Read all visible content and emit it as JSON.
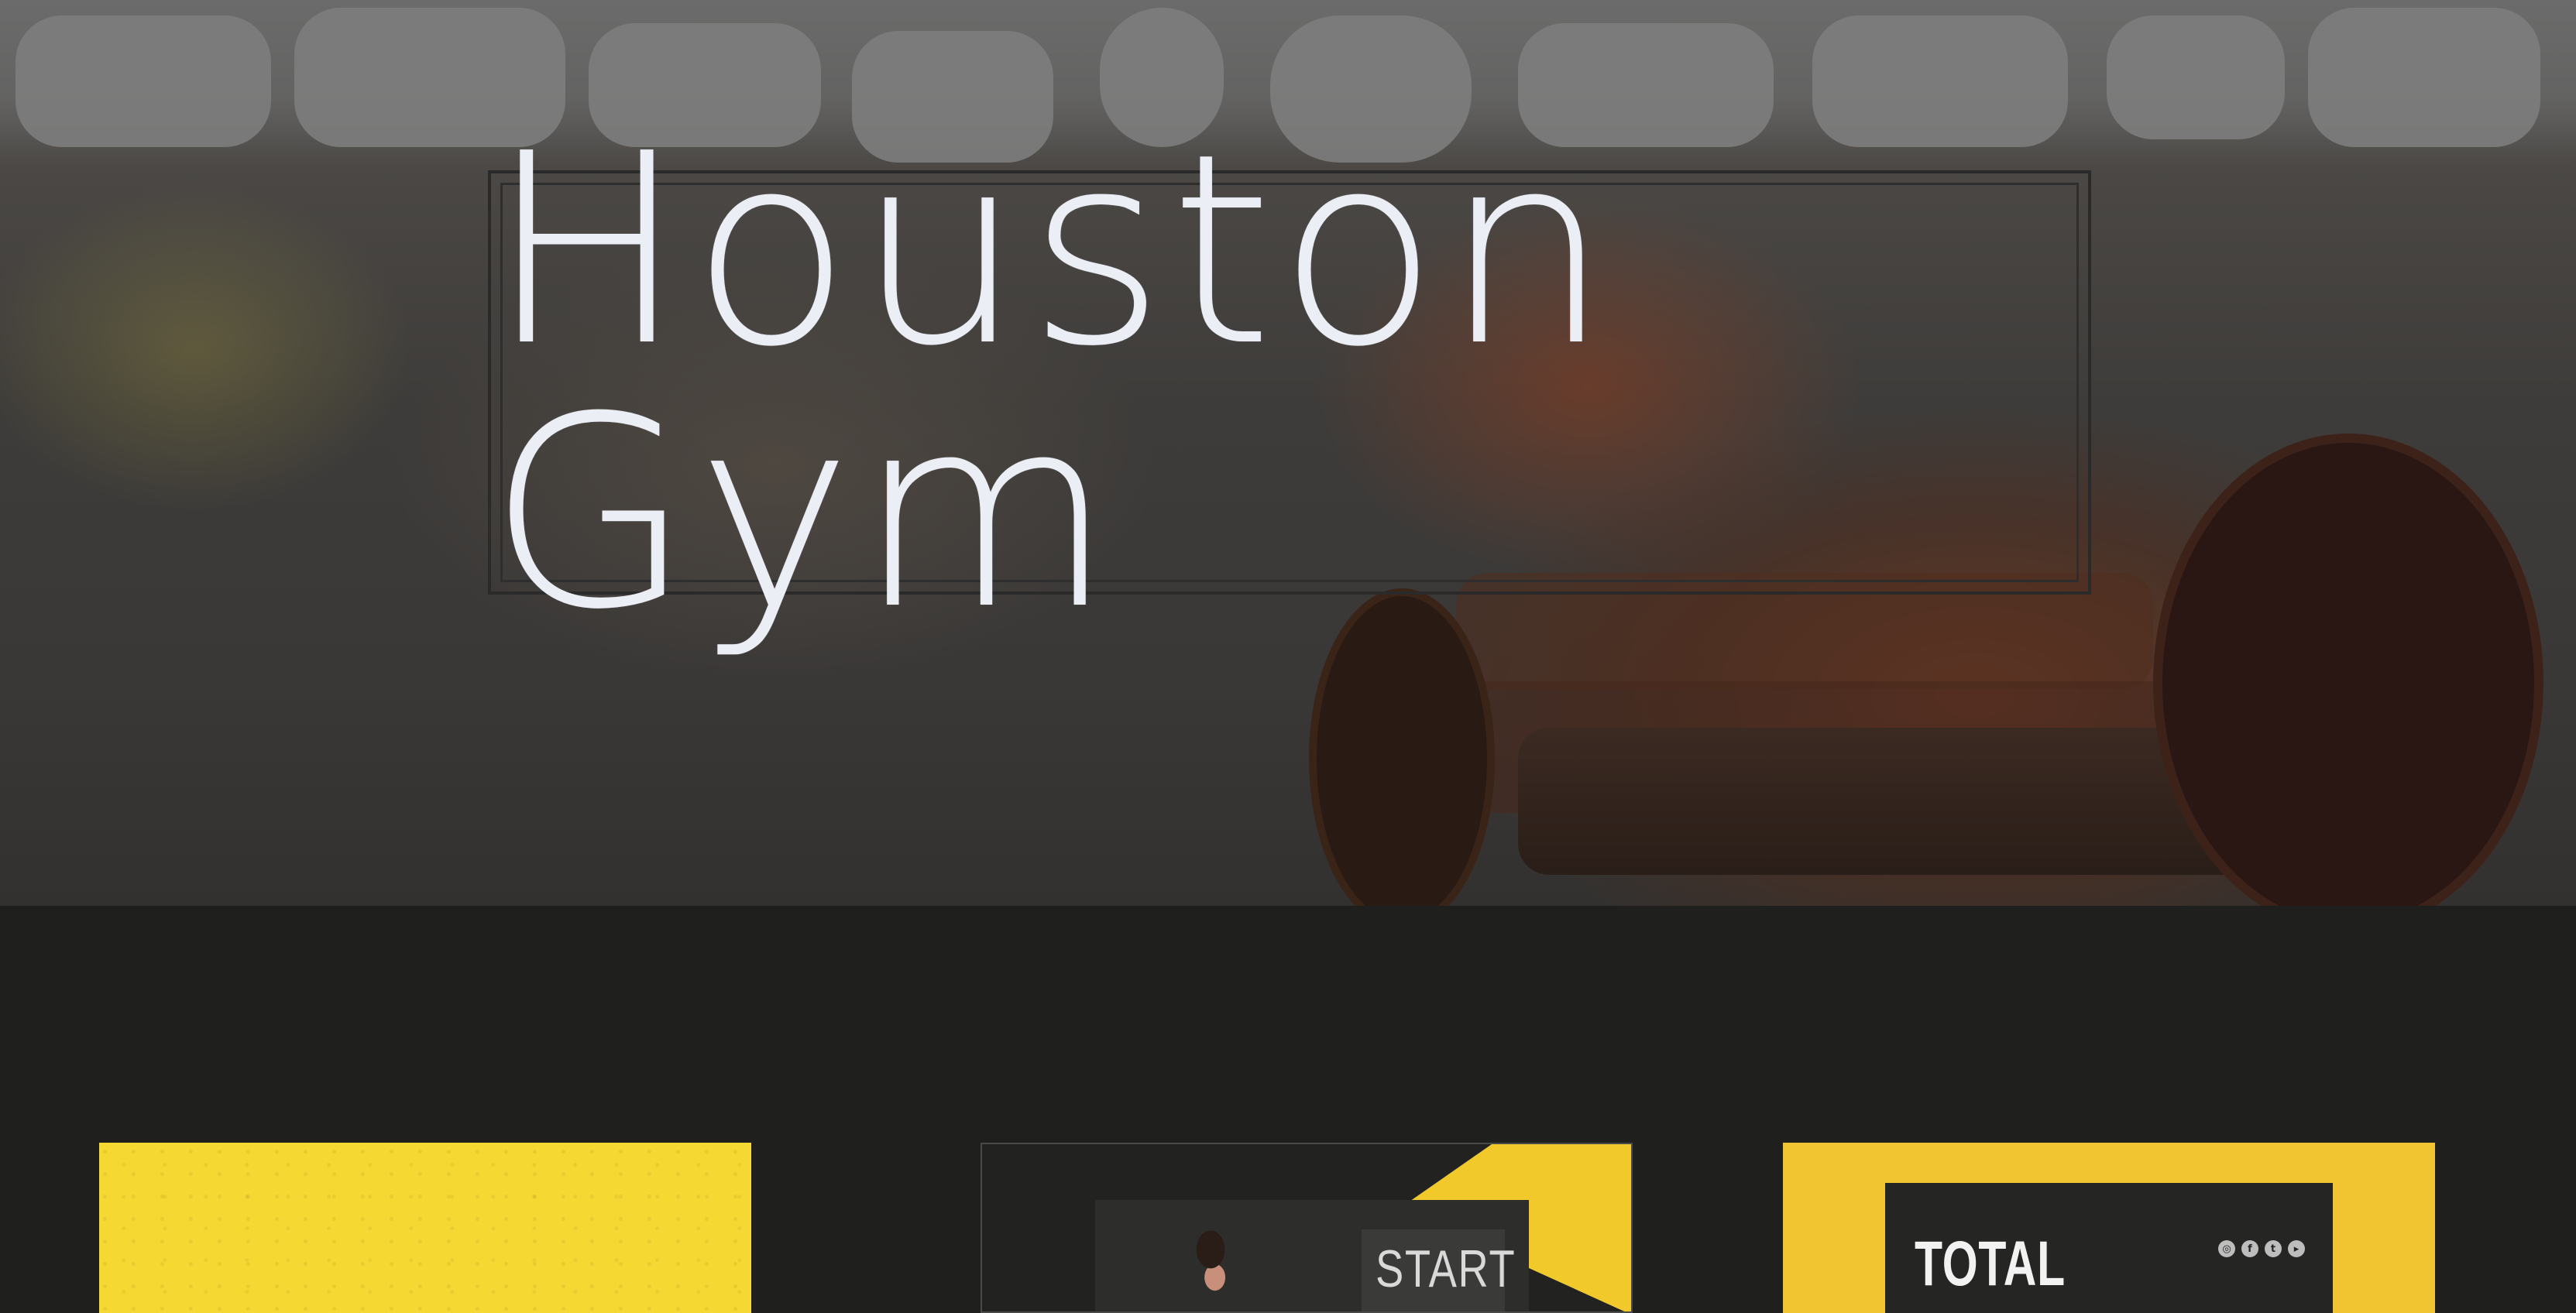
{
  "hero": {
    "title": "Houston Gym"
  },
  "cards": [
    {
      "id": "card-1",
      "text": ""
    },
    {
      "id": "card-2",
      "headline": "START"
    },
    {
      "id": "card-3",
      "headline": "TOTAL",
      "social_icons": [
        "instagram-icon",
        "facebook-icon",
        "twitter-icon",
        "youtube-icon"
      ]
    }
  ],
  "colors": {
    "page_bg": "#1f201d",
    "title_text": "#eceef6",
    "accent_yellow": "#f6d832",
    "accent_gold": "#f0c531"
  }
}
